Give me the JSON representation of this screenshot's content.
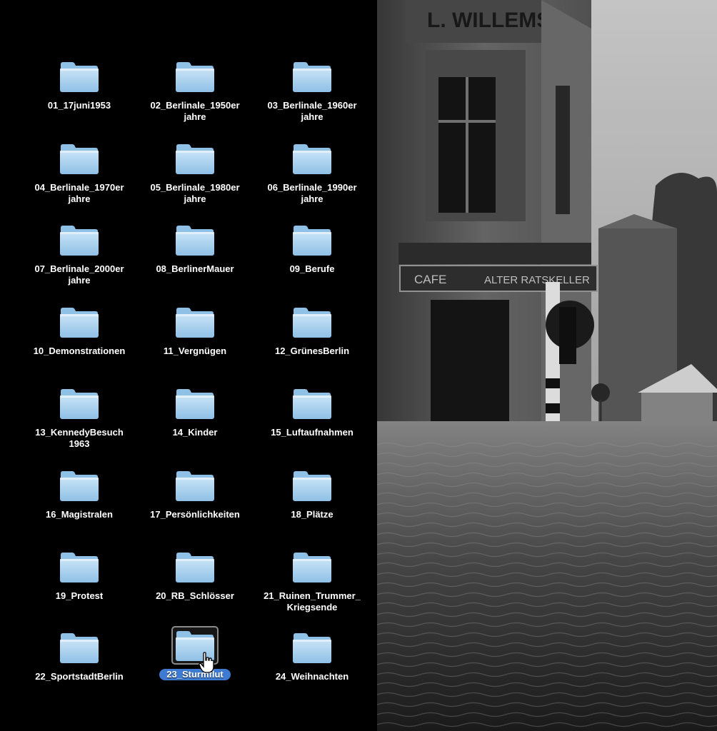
{
  "folders": [
    {
      "label_lines": [
        "01_17juni1953"
      ]
    },
    {
      "label_lines": [
        "02_Berlinale_1950er",
        "jahre"
      ]
    },
    {
      "label_lines": [
        "03_Berlinale_1960er",
        "jahre"
      ]
    },
    {
      "label_lines": [
        "04_Berlinale_1970er",
        "jahre"
      ]
    },
    {
      "label_lines": [
        "05_Berlinale_1980er",
        "jahre"
      ]
    },
    {
      "label_lines": [
        "06_Berlinale_1990er",
        "jahre"
      ]
    },
    {
      "label_lines": [
        "07_Berlinale_2000er",
        "jahre"
      ]
    },
    {
      "label_lines": [
        "08_BerlinerMauer"
      ]
    },
    {
      "label_lines": [
        "09_Berufe"
      ]
    },
    {
      "label_lines": [
        "10_Demonstrationen"
      ]
    },
    {
      "label_lines": [
        "11_Vergnügen"
      ]
    },
    {
      "label_lines": [
        "12_GrünesBerlin"
      ]
    },
    {
      "label_lines": [
        "13_KennedyBesuch",
        "1963"
      ]
    },
    {
      "label_lines": [
        "14_Kinder"
      ]
    },
    {
      "label_lines": [
        "15_Luftaufnahmen"
      ]
    },
    {
      "label_lines": [
        "16_Magistralen"
      ]
    },
    {
      "label_lines": [
        "17_Persönlichkeiten"
      ]
    },
    {
      "label_lines": [
        "18_Plätze"
      ]
    },
    {
      "label_lines": [
        "19_Protest"
      ]
    },
    {
      "label_lines": [
        "20_RB_Schlösser"
      ]
    },
    {
      "label_lines": [
        "21_Ruinen_Trummer_",
        "Kriegsende"
      ]
    },
    {
      "label_lines": [
        "22_SportstadtBerlin"
      ]
    },
    {
      "label_lines": [
        "23_Sturmflut"
      ],
      "selected": true
    },
    {
      "label_lines": [
        "24_Weihnachten"
      ]
    }
  ],
  "photo": {
    "sign_text": "L. WILLEMS",
    "awning_left": "CAFE",
    "awning_right": "ALTER RATSKELLER"
  },
  "colors": {
    "folder_light": "#c9e4f7",
    "folder_dark": "#8fc0e6",
    "selection": "#3d7bd2"
  }
}
